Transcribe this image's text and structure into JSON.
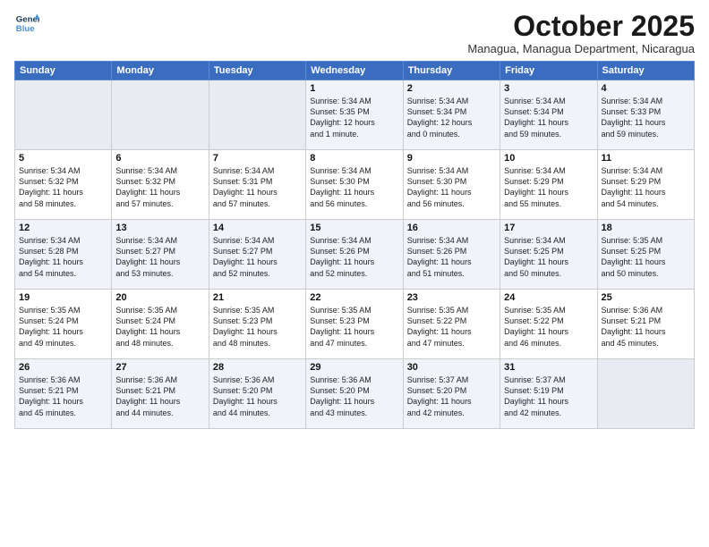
{
  "logo": {
    "line1": "General",
    "line2": "Blue"
  },
  "title": "October 2025",
  "subtitle": "Managua, Managua Department, Nicaragua",
  "days_of_week": [
    "Sunday",
    "Monday",
    "Tuesday",
    "Wednesday",
    "Thursday",
    "Friday",
    "Saturday"
  ],
  "weeks": [
    [
      {
        "day": "",
        "info": ""
      },
      {
        "day": "",
        "info": ""
      },
      {
        "day": "",
        "info": ""
      },
      {
        "day": "1",
        "info": "Sunrise: 5:34 AM\nSunset: 5:35 PM\nDaylight: 12 hours\nand 1 minute."
      },
      {
        "day": "2",
        "info": "Sunrise: 5:34 AM\nSunset: 5:34 PM\nDaylight: 12 hours\nand 0 minutes."
      },
      {
        "day": "3",
        "info": "Sunrise: 5:34 AM\nSunset: 5:34 PM\nDaylight: 11 hours\nand 59 minutes."
      },
      {
        "day": "4",
        "info": "Sunrise: 5:34 AM\nSunset: 5:33 PM\nDaylight: 11 hours\nand 59 minutes."
      }
    ],
    [
      {
        "day": "5",
        "info": "Sunrise: 5:34 AM\nSunset: 5:32 PM\nDaylight: 11 hours\nand 58 minutes."
      },
      {
        "day": "6",
        "info": "Sunrise: 5:34 AM\nSunset: 5:32 PM\nDaylight: 11 hours\nand 57 minutes."
      },
      {
        "day": "7",
        "info": "Sunrise: 5:34 AM\nSunset: 5:31 PM\nDaylight: 11 hours\nand 57 minutes."
      },
      {
        "day": "8",
        "info": "Sunrise: 5:34 AM\nSunset: 5:30 PM\nDaylight: 11 hours\nand 56 minutes."
      },
      {
        "day": "9",
        "info": "Sunrise: 5:34 AM\nSunset: 5:30 PM\nDaylight: 11 hours\nand 56 minutes."
      },
      {
        "day": "10",
        "info": "Sunrise: 5:34 AM\nSunset: 5:29 PM\nDaylight: 11 hours\nand 55 minutes."
      },
      {
        "day": "11",
        "info": "Sunrise: 5:34 AM\nSunset: 5:29 PM\nDaylight: 11 hours\nand 54 minutes."
      }
    ],
    [
      {
        "day": "12",
        "info": "Sunrise: 5:34 AM\nSunset: 5:28 PM\nDaylight: 11 hours\nand 54 minutes."
      },
      {
        "day": "13",
        "info": "Sunrise: 5:34 AM\nSunset: 5:27 PM\nDaylight: 11 hours\nand 53 minutes."
      },
      {
        "day": "14",
        "info": "Sunrise: 5:34 AM\nSunset: 5:27 PM\nDaylight: 11 hours\nand 52 minutes."
      },
      {
        "day": "15",
        "info": "Sunrise: 5:34 AM\nSunset: 5:26 PM\nDaylight: 11 hours\nand 52 minutes."
      },
      {
        "day": "16",
        "info": "Sunrise: 5:34 AM\nSunset: 5:26 PM\nDaylight: 11 hours\nand 51 minutes."
      },
      {
        "day": "17",
        "info": "Sunrise: 5:34 AM\nSunset: 5:25 PM\nDaylight: 11 hours\nand 50 minutes."
      },
      {
        "day": "18",
        "info": "Sunrise: 5:35 AM\nSunset: 5:25 PM\nDaylight: 11 hours\nand 50 minutes."
      }
    ],
    [
      {
        "day": "19",
        "info": "Sunrise: 5:35 AM\nSunset: 5:24 PM\nDaylight: 11 hours\nand 49 minutes."
      },
      {
        "day": "20",
        "info": "Sunrise: 5:35 AM\nSunset: 5:24 PM\nDaylight: 11 hours\nand 48 minutes."
      },
      {
        "day": "21",
        "info": "Sunrise: 5:35 AM\nSunset: 5:23 PM\nDaylight: 11 hours\nand 48 minutes."
      },
      {
        "day": "22",
        "info": "Sunrise: 5:35 AM\nSunset: 5:23 PM\nDaylight: 11 hours\nand 47 minutes."
      },
      {
        "day": "23",
        "info": "Sunrise: 5:35 AM\nSunset: 5:22 PM\nDaylight: 11 hours\nand 47 minutes."
      },
      {
        "day": "24",
        "info": "Sunrise: 5:35 AM\nSunset: 5:22 PM\nDaylight: 11 hours\nand 46 minutes."
      },
      {
        "day": "25",
        "info": "Sunrise: 5:36 AM\nSunset: 5:21 PM\nDaylight: 11 hours\nand 45 minutes."
      }
    ],
    [
      {
        "day": "26",
        "info": "Sunrise: 5:36 AM\nSunset: 5:21 PM\nDaylight: 11 hours\nand 45 minutes."
      },
      {
        "day": "27",
        "info": "Sunrise: 5:36 AM\nSunset: 5:21 PM\nDaylight: 11 hours\nand 44 minutes."
      },
      {
        "day": "28",
        "info": "Sunrise: 5:36 AM\nSunset: 5:20 PM\nDaylight: 11 hours\nand 44 minutes."
      },
      {
        "day": "29",
        "info": "Sunrise: 5:36 AM\nSunset: 5:20 PM\nDaylight: 11 hours\nand 43 minutes."
      },
      {
        "day": "30",
        "info": "Sunrise: 5:37 AM\nSunset: 5:20 PM\nDaylight: 11 hours\nand 42 minutes."
      },
      {
        "day": "31",
        "info": "Sunrise: 5:37 AM\nSunset: 5:19 PM\nDaylight: 11 hours\nand 42 minutes."
      },
      {
        "day": "",
        "info": ""
      }
    ]
  ]
}
